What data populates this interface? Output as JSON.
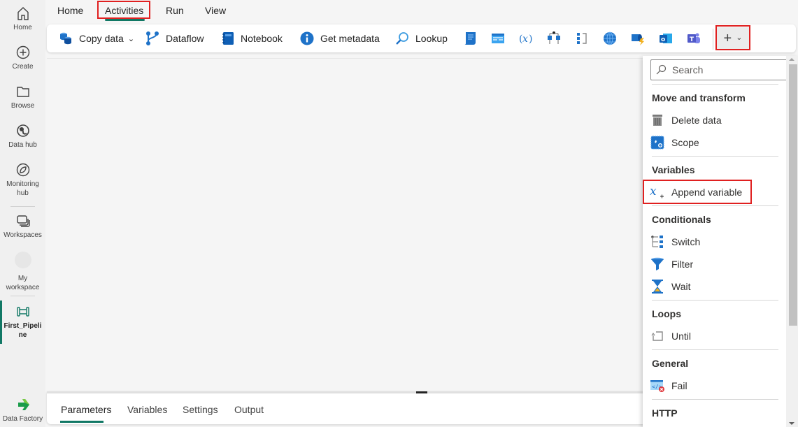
{
  "rail": {
    "items": [
      {
        "label": "Home",
        "icon": "home-icon"
      },
      {
        "label": "Create",
        "icon": "plus-circle-icon"
      },
      {
        "label": "Browse",
        "icon": "folder-icon"
      },
      {
        "label": "Data hub",
        "icon": "data-hub-icon"
      },
      {
        "label": "Monitoring hub",
        "icon": "monitoring-icon"
      },
      {
        "label": "Workspaces",
        "icon": "workspaces-icon"
      },
      {
        "label": "My workspace",
        "icon": "avatar"
      },
      {
        "label": "First_Pipeline",
        "icon": "pipeline-icon"
      }
    ],
    "footer": {
      "label": "Data Factory",
      "icon": "data-factory-logo"
    }
  },
  "menu": {
    "tabs": [
      {
        "label": "Home"
      },
      {
        "label": "Activities",
        "active": true
      },
      {
        "label": "Run"
      },
      {
        "label": "View"
      }
    ]
  },
  "toolbar": {
    "buttons": [
      {
        "label": "Copy data",
        "icon": "copy-data-icon",
        "has_dropdown": true
      },
      {
        "label": "Dataflow",
        "icon": "dataflow-icon"
      },
      {
        "label": "Notebook",
        "icon": "notebook-icon"
      },
      {
        "label": "Get metadata",
        "icon": "info-icon"
      },
      {
        "label": "Lookup",
        "icon": "lookup-icon"
      }
    ],
    "icon_buttons": [
      "script-icon",
      "stored-procedure-icon",
      "set-variable-icon",
      "if-condition-icon",
      "foreach-icon",
      "web-icon",
      "azure-function-icon",
      "outlook-icon",
      "teams-icon"
    ],
    "add_button": {
      "symbol": "+",
      "chevron": "⌄"
    }
  },
  "bottom_panel": {
    "tabs": [
      {
        "label": "Parameters",
        "active": true
      },
      {
        "label": "Variables"
      },
      {
        "label": "Settings"
      },
      {
        "label": "Output"
      }
    ]
  },
  "dropdown": {
    "search_placeholder": "Search",
    "sections": [
      {
        "header": "Move and transform",
        "items": [
          {
            "label": "Delete data",
            "icon": "trash-icon"
          },
          {
            "label": "Scope",
            "icon": "scope-icon"
          }
        ]
      },
      {
        "header": "Variables",
        "items": [
          {
            "label": "Append variable",
            "icon": "append-variable-icon",
            "highlighted": true
          }
        ]
      },
      {
        "header": "Conditionals",
        "items": [
          {
            "label": "Switch",
            "icon": "switch-icon"
          },
          {
            "label": "Filter",
            "icon": "filter-icon"
          },
          {
            "label": "Wait",
            "icon": "hourglass-icon"
          }
        ]
      },
      {
        "header": "Loops",
        "items": [
          {
            "label": "Until",
            "icon": "until-icon"
          }
        ]
      },
      {
        "header": "General",
        "items": [
          {
            "label": "Fail",
            "icon": "fail-icon"
          }
        ]
      },
      {
        "header": "HTTP",
        "items": []
      }
    ]
  },
  "colors": {
    "accent": "#117865",
    "highlight": "#e02020",
    "icon_blue": "#1e72c8"
  }
}
